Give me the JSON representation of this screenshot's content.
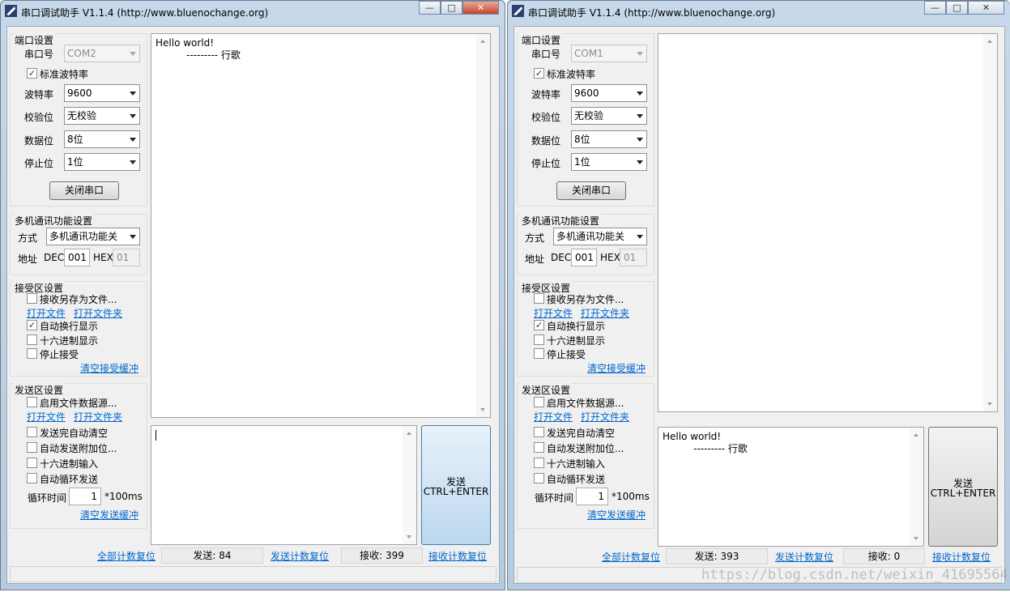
{
  "windows": [
    {
      "title": "串口调试助手 V1.1.4 (http://www.bluenochange.org)",
      "port_settings": {
        "group_title": "端口设置",
        "port_label": "串口号",
        "port_value": "COM2",
        "std_baud_label": "标准波特率",
        "std_baud_checked": true,
        "baud_label": "波特率",
        "baud_value": "9600",
        "parity_label": "校验位",
        "parity_value": "无校验",
        "databits_label": "数据位",
        "databits_value": "8位",
        "stopbits_label": "停止位",
        "stopbits_value": "1位",
        "close_button": "关闭串口"
      },
      "multi": {
        "group_title": "多机通讯功能设置",
        "mode_label": "方式",
        "mode_value": "多机通讯功能关",
        "addr_label": "地址",
        "dec_label": "DEC",
        "dec_value": "001",
        "hex_label": "HEX",
        "hex_value": "01"
      },
      "receive_settings": {
        "group_title": "接受区设置",
        "save_to_file": "接收另存为文件...",
        "open_file": "打开文件",
        "open_folder": "打开文件夹",
        "auto_wrap": "自动换行显示",
        "auto_wrap_checked": true,
        "hex_display": "十六进制显示",
        "hex_display_checked": false,
        "stop_receive": "停止接受",
        "stop_receive_checked": false,
        "clear": "清空接受缓冲"
      },
      "send_settings": {
        "group_title": "发送区设置",
        "file_source": "启用文件数据源...",
        "open_file": "打开文件",
        "open_folder": "打开文件夹",
        "auto_clear": "发送完自动清空",
        "append": "自动发送附加位...",
        "hex_input": "十六进制输入",
        "loop_send": "自动循环发送",
        "cycle_label": "循环时间",
        "cycle_value": "1",
        "cycle_unit": "*100ms",
        "clear": "清空发送缓冲"
      },
      "receive_text": "Hello world!\n          --------- 行歌",
      "send_text": "",
      "send_button_line1": "发送",
      "send_button_line2": "CTRL+ENTER",
      "reset_all": "全部计数复位",
      "sent_count": "发送: 84",
      "reset_sent": "发送计数复位",
      "recv_count": "接收: 399",
      "reset_recv": "接收计数复位"
    },
    {
      "title": "串口调试助手 V1.1.4 (http://www.bluenochange.org)",
      "port_settings": {
        "group_title": "端口设置",
        "port_label": "串口号",
        "port_value": "COM1",
        "std_baud_label": "标准波特率",
        "std_baud_checked": true,
        "baud_label": "波特率",
        "baud_value": "9600",
        "parity_label": "校验位",
        "parity_value": "无校验",
        "databits_label": "数据位",
        "databits_value": "8位",
        "stopbits_label": "停止位",
        "stopbits_value": "1位",
        "close_button": "关闭串口"
      },
      "multi": {
        "group_title": "多机通讯功能设置",
        "mode_label": "方式",
        "mode_value": "多机通讯功能关",
        "addr_label": "地址",
        "dec_label": "DEC",
        "dec_value": "001",
        "hex_label": "HEX",
        "hex_value": "01"
      },
      "receive_settings": {
        "group_title": "接受区设置",
        "save_to_file": "接收另存为文件...",
        "open_file": "打开文件",
        "open_folder": "打开文件夹",
        "auto_wrap": "自动换行显示",
        "auto_wrap_checked": true,
        "hex_display": "十六进制显示",
        "hex_display_checked": false,
        "stop_receive": "停止接受",
        "stop_receive_checked": false,
        "clear": "清空接受缓冲"
      },
      "send_settings": {
        "group_title": "发送区设置",
        "file_source": "启用文件数据源...",
        "open_file": "打开文件",
        "open_folder": "打开文件夹",
        "auto_clear": "发送完自动清空",
        "append": "自动发送附加位...",
        "hex_input": "十六进制输入",
        "loop_send": "自动循环发送",
        "cycle_label": "循环时间",
        "cycle_value": "1",
        "cycle_unit": "*100ms",
        "clear": "清空发送缓冲"
      },
      "receive_text": "",
      "send_text": "Hello world!\n          --------- 行歌",
      "send_button_line1": "发送",
      "send_button_line2": "CTRL+ENTER",
      "reset_all": "全部计数复位",
      "sent_count": "发送: 393",
      "reset_sent": "发送计数复位",
      "recv_count": "接收: 0",
      "reset_recv": "接收计数复位"
    }
  ],
  "watermark": "https://blog.csdn.net/weixin_41695564",
  "window_controls": {
    "minimize": "—",
    "maximize": "□",
    "close": "✕"
  }
}
